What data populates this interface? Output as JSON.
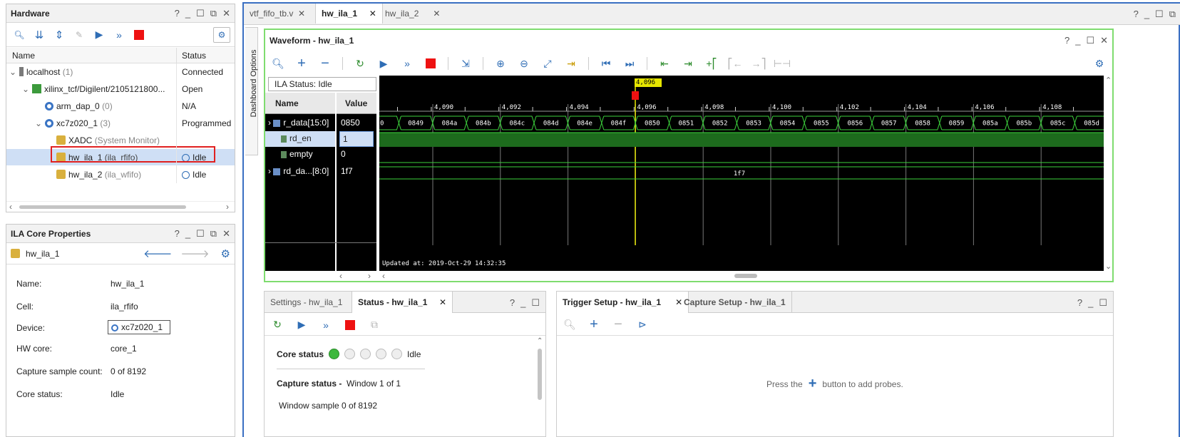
{
  "hardware": {
    "title": "Hardware",
    "col_name": "Name",
    "col_status": "Status",
    "rows": [
      {
        "name": "localhost",
        "suffix": "(1)",
        "status": "Connected"
      },
      {
        "name": "xilinx_tcf/Digilent/2105121800...",
        "suffix": "",
        "status": "Open"
      },
      {
        "name": "arm_dap_0",
        "suffix": "(0)",
        "status": "N/A"
      },
      {
        "name": "xc7z020_1",
        "suffix": "(3)",
        "status": "Programmed"
      },
      {
        "name": "XADC",
        "suffix": "(System Monitor)",
        "status": ""
      },
      {
        "name": "hw_ila_1",
        "suffix": "(ila_rfifo)",
        "status": "Idle"
      },
      {
        "name": "hw_ila_2",
        "suffix": "(ila_wfifo)",
        "status": "Idle"
      }
    ]
  },
  "props": {
    "title": "ILA Core Properties",
    "core": "hw_ila_1",
    "items": [
      {
        "label": "Name:",
        "value": "hw_ila_1"
      },
      {
        "label": "Cell:",
        "value": "ila_rfifo"
      },
      {
        "label": "Device:",
        "value": "xc7z020_1"
      },
      {
        "label": "HW core:",
        "value": "core_1"
      },
      {
        "label": "Capture sample count:",
        "value": "0 of 8192"
      },
      {
        "label": "Core status:",
        "value": "Idle"
      }
    ]
  },
  "editor_tabs": [
    "vtf_fifo_tb.v",
    "hw_ila_1",
    "hw_ila_2"
  ],
  "dashboard_label": "Dashboard Options",
  "waveform": {
    "title": "Waveform - hw_ila_1",
    "ila_status": "ILA Status:  Idle",
    "col_name": "Name",
    "col_value": "Value",
    "cursor": "4,096",
    "ticks": [
      "4,090",
      "4,092",
      "4,094",
      "4,096",
      "4,098",
      "4,100",
      "4,102",
      "4,104",
      "4,106",
      "4,108"
    ],
    "signals": [
      {
        "name": "r_data[15:0]",
        "value": "0850"
      },
      {
        "name": "rd_en",
        "value": "1"
      },
      {
        "name": "empty",
        "value": "0"
      },
      {
        "name": "rd_da...[8:0]",
        "value": "1f7"
      }
    ],
    "bus1": [
      "0",
      "0849",
      "084a",
      "084b",
      "084c",
      "084d",
      "084e",
      "084f",
      "0850",
      "0851",
      "0852",
      "0853",
      "0854",
      "0855",
      "0856",
      "0857",
      "0858",
      "0859",
      "085a",
      "085b",
      "085c",
      "085d"
    ],
    "bus2": "1f7",
    "updated": "Updated at: 2019-Oct-29 14:32:35"
  },
  "status_panel": {
    "tabs": [
      "Settings - hw_ila_1",
      "Status - hw_ila_1"
    ],
    "core_status_label": "Core status",
    "core_status_value": "Idle",
    "capture_label": "Capture status -",
    "capture_value": "Window 1 of 1",
    "window_sample": "Window sample 0 of 8192"
  },
  "trigger_panel": {
    "tabs": [
      "Trigger Setup - hw_ila_1",
      "Capture Setup - hw_ila_1"
    ],
    "hint_pre": "Press the",
    "hint_post": "button to add probes."
  }
}
